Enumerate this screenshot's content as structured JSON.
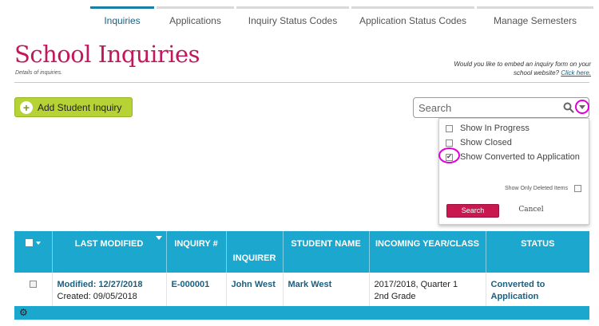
{
  "tabs": [
    {
      "label": "Inquiries",
      "active": true
    },
    {
      "label": "Applications"
    },
    {
      "label": "Inquiry Status Codes"
    },
    {
      "label": "Application Status Codes"
    },
    {
      "label": "Manage Semesters"
    }
  ],
  "page": {
    "title": "School Inquiries",
    "subtitle": "Details of inquiries.",
    "embed_text": "Would you like to embed an inquiry form on your school website?",
    "embed_link": "Click here."
  },
  "toolbar": {
    "add_label": "Add Student Inquiry"
  },
  "search": {
    "placeholder": "Search"
  },
  "filters": {
    "options": [
      {
        "label": "Show In Progress",
        "checked": false
      },
      {
        "label": "Show Closed",
        "checked": false
      },
      {
        "label": "Show Converted to Application",
        "checked": true
      }
    ],
    "deleted_label": "Show Only Deleted Items",
    "search_button": "Search",
    "cancel_button": "Cancel"
  },
  "table": {
    "headers": {
      "last_modified": "LAST MODIFIED",
      "inquiry_no": "INQUIRY #",
      "inquirer": "INQUIRER",
      "student_name": "STUDENT NAME",
      "incoming": "INCOMING YEAR/CLASS",
      "status": "STATUS"
    },
    "rows": [
      {
        "modified": "Modified: 12/27/2018",
        "created": "Created: 09/05/2018",
        "inquiry_no": "E-000001",
        "inquirer": "John West",
        "student": "Mark West",
        "incoming_line1": "2017/2018, Quarter 1",
        "incoming_line2": "2nd Grade",
        "status": "Converted to Application"
      }
    ]
  },
  "colors": {
    "accent": "#1ca7cf",
    "title": "#c2185b",
    "add_button": "#b5d334",
    "highlight": "#e000d9"
  },
  "icons": [
    "plus-icon",
    "search-icon",
    "chevron-down-icon",
    "gear-icon"
  ]
}
